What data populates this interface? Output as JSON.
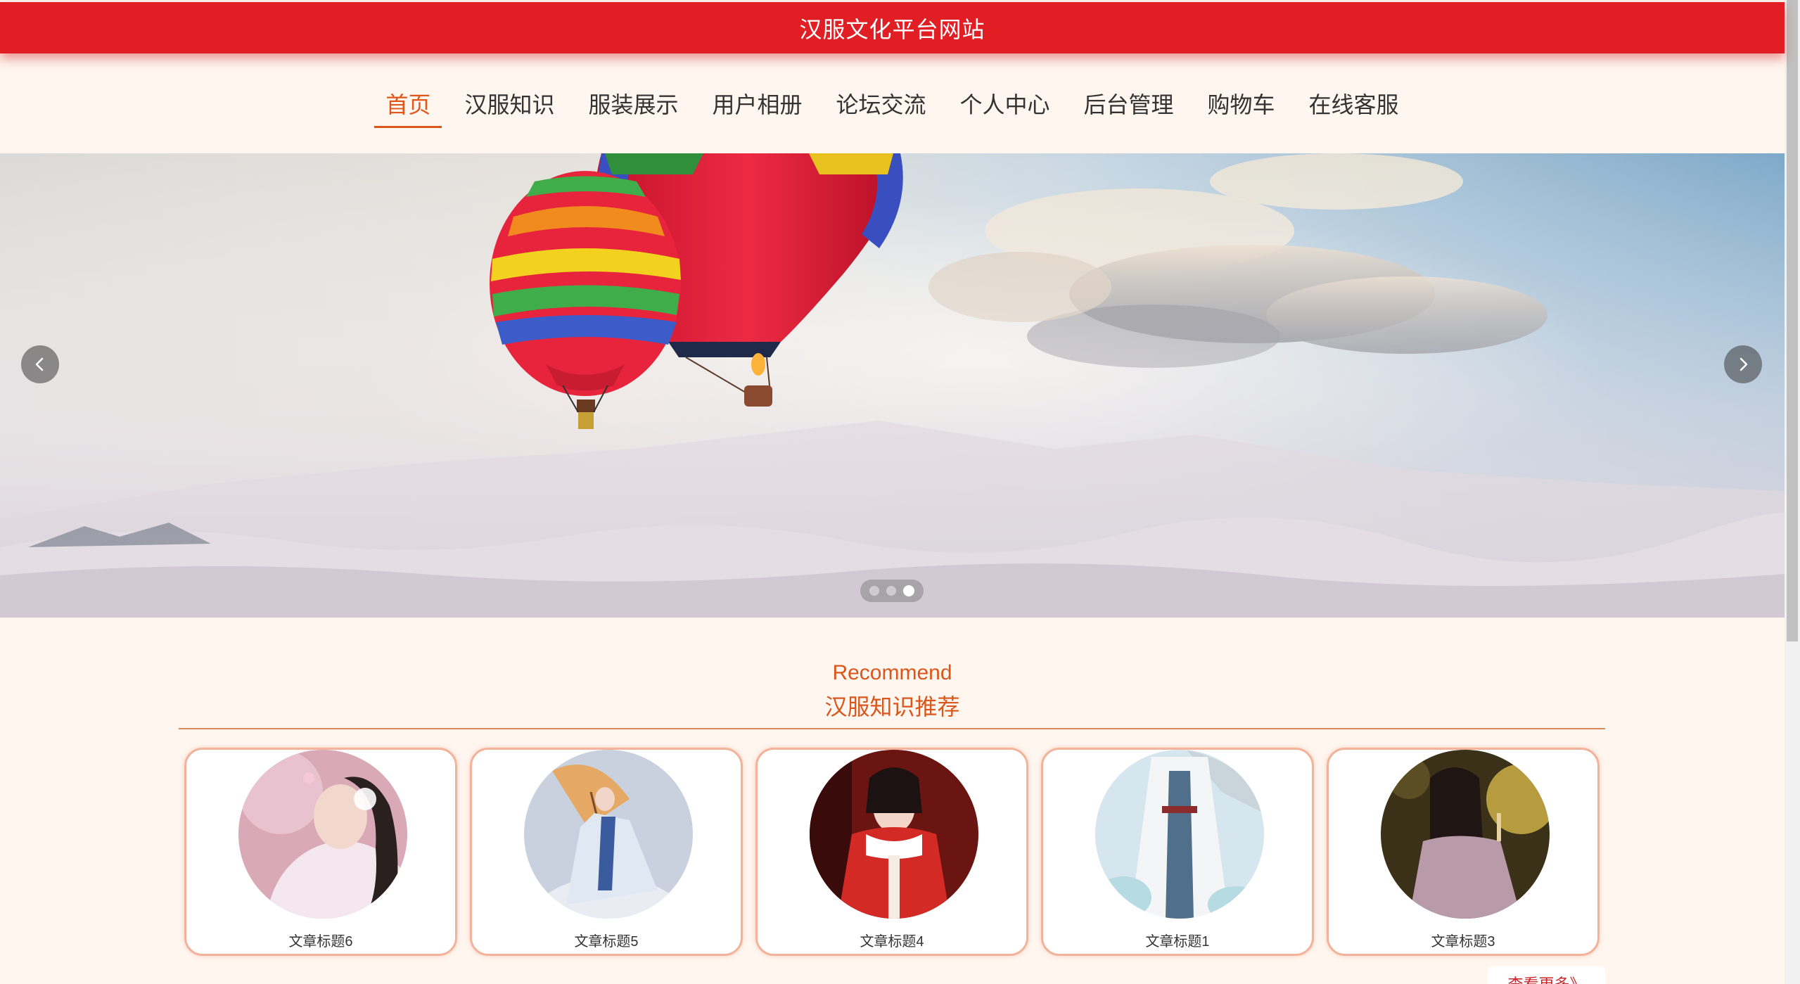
{
  "header": {
    "site_title": "汉服文化平台网站"
  },
  "nav": {
    "items": [
      {
        "label": "首页",
        "active": true
      },
      {
        "label": "汉服知识",
        "active": false
      },
      {
        "label": "服装展示",
        "active": false
      },
      {
        "label": "用户相册",
        "active": false
      },
      {
        "label": "论坛交流",
        "active": false
      },
      {
        "label": "个人中心",
        "active": false
      },
      {
        "label": "后台管理",
        "active": false
      },
      {
        "label": "购物车",
        "active": false
      },
      {
        "label": "在线客服",
        "active": false
      }
    ]
  },
  "carousel": {
    "prev_icon": "chevron-left-icon",
    "next_icon": "chevron-right-icon",
    "slide_count": 3,
    "active_slide": 3
  },
  "recommend": {
    "title_en": "Recommend",
    "title_cn": "汉服知识推荐",
    "cards": [
      {
        "title": "文章标题6"
      },
      {
        "title": "文章标题5"
      },
      {
        "title": "文章标题4"
      },
      {
        "title": "文章标题1"
      },
      {
        "title": "文章标题3"
      }
    ],
    "more_label": "查看更多》"
  },
  "colors": {
    "header_red": "#e01e24",
    "accent_orange": "#d9571c",
    "page_bg": "#fff6ef"
  }
}
